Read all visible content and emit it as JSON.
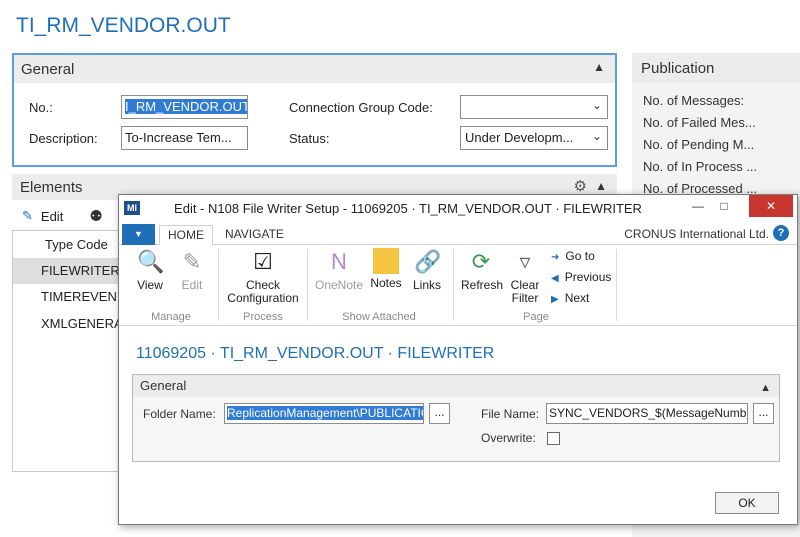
{
  "page": {
    "title": "TI_RM_VENDOR.OUT"
  },
  "general": {
    "header": "General",
    "no_label": "No.:",
    "no_value": "I_RM_VENDOR.OUT",
    "description_label": "Description:",
    "description_value": "To-Increase Tem...",
    "connection_group_label": "Connection Group Code:",
    "connection_group_value": "",
    "status_label": "Status:",
    "status_value": "Under Developm..."
  },
  "publication": {
    "header": "Publication",
    "items": [
      "No. of Messages:",
      "No. of Failed Mes...",
      "No. of Pending M...",
      "No. of In Process ...",
      "No. of Processed ..."
    ]
  },
  "elements": {
    "header": "Elements",
    "edit_label": "Edit",
    "column_header": "Type Code",
    "rows": [
      "FILEWRITER",
      "TIMEREVEN",
      "XMLGENERA"
    ]
  },
  "dialog": {
    "title": "Edit - N108 File Writer Setup - 11069205 · TI_RM_VENDOR.OUT · FILEWRITER",
    "tabs": [
      "HOME",
      "NAVIGATE"
    ],
    "company": "CRONUS International Ltd.",
    "ribbon": {
      "view": "View",
      "edit": "Edit",
      "manage_group": "Manage",
      "check_config": "Check Configuration",
      "process_group": "Process",
      "onenote": "OneNote",
      "notes": "Notes",
      "links": "Links",
      "attached_group": "Show Attached",
      "refresh": "Refresh",
      "clear_filter": "Clear Filter",
      "goto": "Go to",
      "previous": "Previous",
      "next": "Next",
      "page_group": "Page"
    },
    "subtitle": "11069205 · TI_RM_VENDOR.OUT · FILEWRITER",
    "general_header": "General",
    "folder_label": "Folder Name:",
    "folder_value": "ReplicationManagement\\PUBLICATION",
    "file_label": "File Name:",
    "file_value": "SYNC_VENDORS_$(MessageNumber)....",
    "overwrite_label": "Overwrite:",
    "overwrite_checked": false,
    "dots": "...",
    "ok": "OK"
  }
}
